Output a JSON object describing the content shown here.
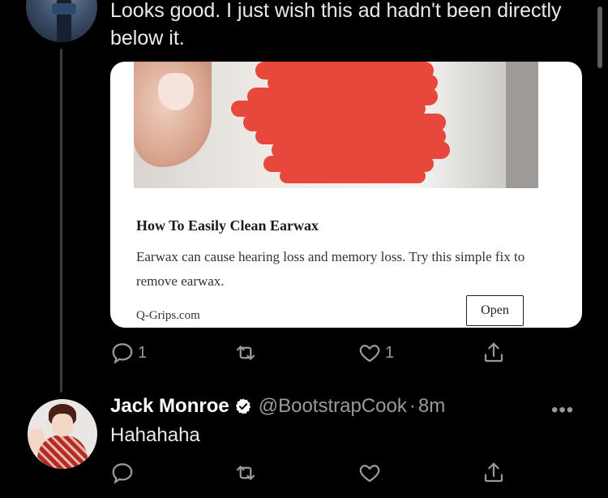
{
  "tweet": {
    "text": "Looks good. I just wish this ad hadn't been directly below it.",
    "card": {
      "title": "How To Easily Clean Earwax",
      "description": "Earwax can cause hearing loss and memory loss. Try this simple fix to remove earwax.",
      "domain": "Q-Grips.com",
      "open_label": "Open"
    },
    "actions": {
      "replies": "1",
      "retweets": "",
      "likes": "1"
    }
  },
  "reply": {
    "author_name": "Jack Monroe",
    "handle": "@BootstrapCook",
    "separator": "·",
    "time": "8m",
    "text": "Hahahaha",
    "actions": {
      "replies": "",
      "retweets": "",
      "likes": ""
    }
  },
  "icons": [
    "reply-icon",
    "retweet-icon",
    "like-icon",
    "share-icon",
    "verified-badge-icon",
    "more-icon"
  ],
  "colors": {
    "background": "#000000",
    "muted": "#9a9a9a",
    "redaction": "#e8473b",
    "verified": "#ffffff"
  }
}
